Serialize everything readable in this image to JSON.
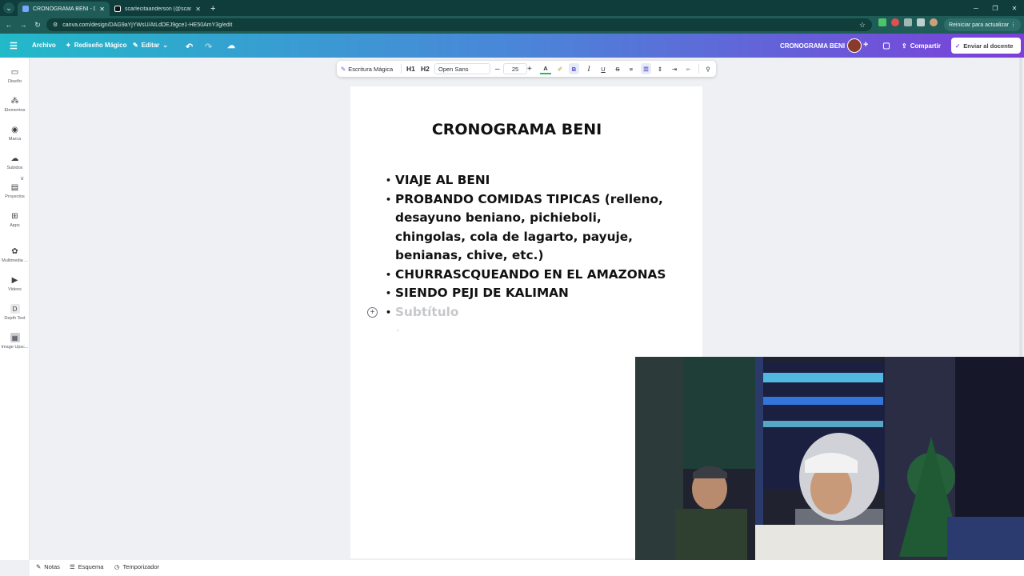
{
  "browser": {
    "tabs": [
      {
        "title": "CRONOGRAMA BENI - Doc",
        "active": true
      },
      {
        "title": "scarlecitaanderson (@scarlehtita…",
        "active": false
      }
    ],
    "url": "canva.com/design/DAG9aYjYWsU/AtLdDEJ9gce1-HE50AmY3g/edit",
    "restart_label": "Reiniciar para actualizar"
  },
  "topbar": {
    "file": "Archivo",
    "magic_redesign": "Rediseño Mágico",
    "edit": "Editar",
    "doc_name": "CRONOGRAMA BENI",
    "share": "Compartir",
    "send": "Enviar al docente"
  },
  "sidebar": {
    "items": [
      {
        "label": "Diseño",
        "icon": "layout-icon"
      },
      {
        "label": "Elementos",
        "icon": "shapes-icon"
      },
      {
        "label": "Marca",
        "icon": "brand-icon"
      },
      {
        "label": "Subidos",
        "icon": "cloud-upload-icon"
      },
      {
        "label": "Proyectos",
        "icon": "folder-icon"
      },
      {
        "label": "Apps",
        "icon": "apps-grid-icon"
      },
      {
        "label": "Multimedia ...",
        "icon": "media-icon"
      },
      {
        "label": "Videos",
        "icon": "video-icon"
      },
      {
        "label": "Depth Text",
        "icon": "depth-text-icon"
      },
      {
        "label": "Image Upsc...",
        "icon": "image-upscale-icon"
      }
    ]
  },
  "text_toolbar": {
    "magic_write": "Escritura Mágica",
    "h1": "H1",
    "h2": "H2",
    "font": "Open Sans",
    "size": "25"
  },
  "document": {
    "title": "CRONOGRAMA BENI",
    "bullets": [
      "VIAJE AL BENI",
      "PROBANDO COMIDAS TIPICAS (relleno, desayuno beniano, pichieboli, chingolas, cola de lagarto, payuje, benianas, chive, etc.)",
      "CHURRASCQUEANDO EN EL AMAZONAS",
      "SIENDO PEJI DE KALIMAN"
    ],
    "placeholder": "Subtítulo"
  },
  "bottom": {
    "notes": "Notas",
    "outline": "Esquema",
    "timer": "Temporizador"
  },
  "colors": {
    "gradient_start": "#22b9c9",
    "gradient_end": "#7c3fd9",
    "browser_dark": "#0f3d3b"
  }
}
